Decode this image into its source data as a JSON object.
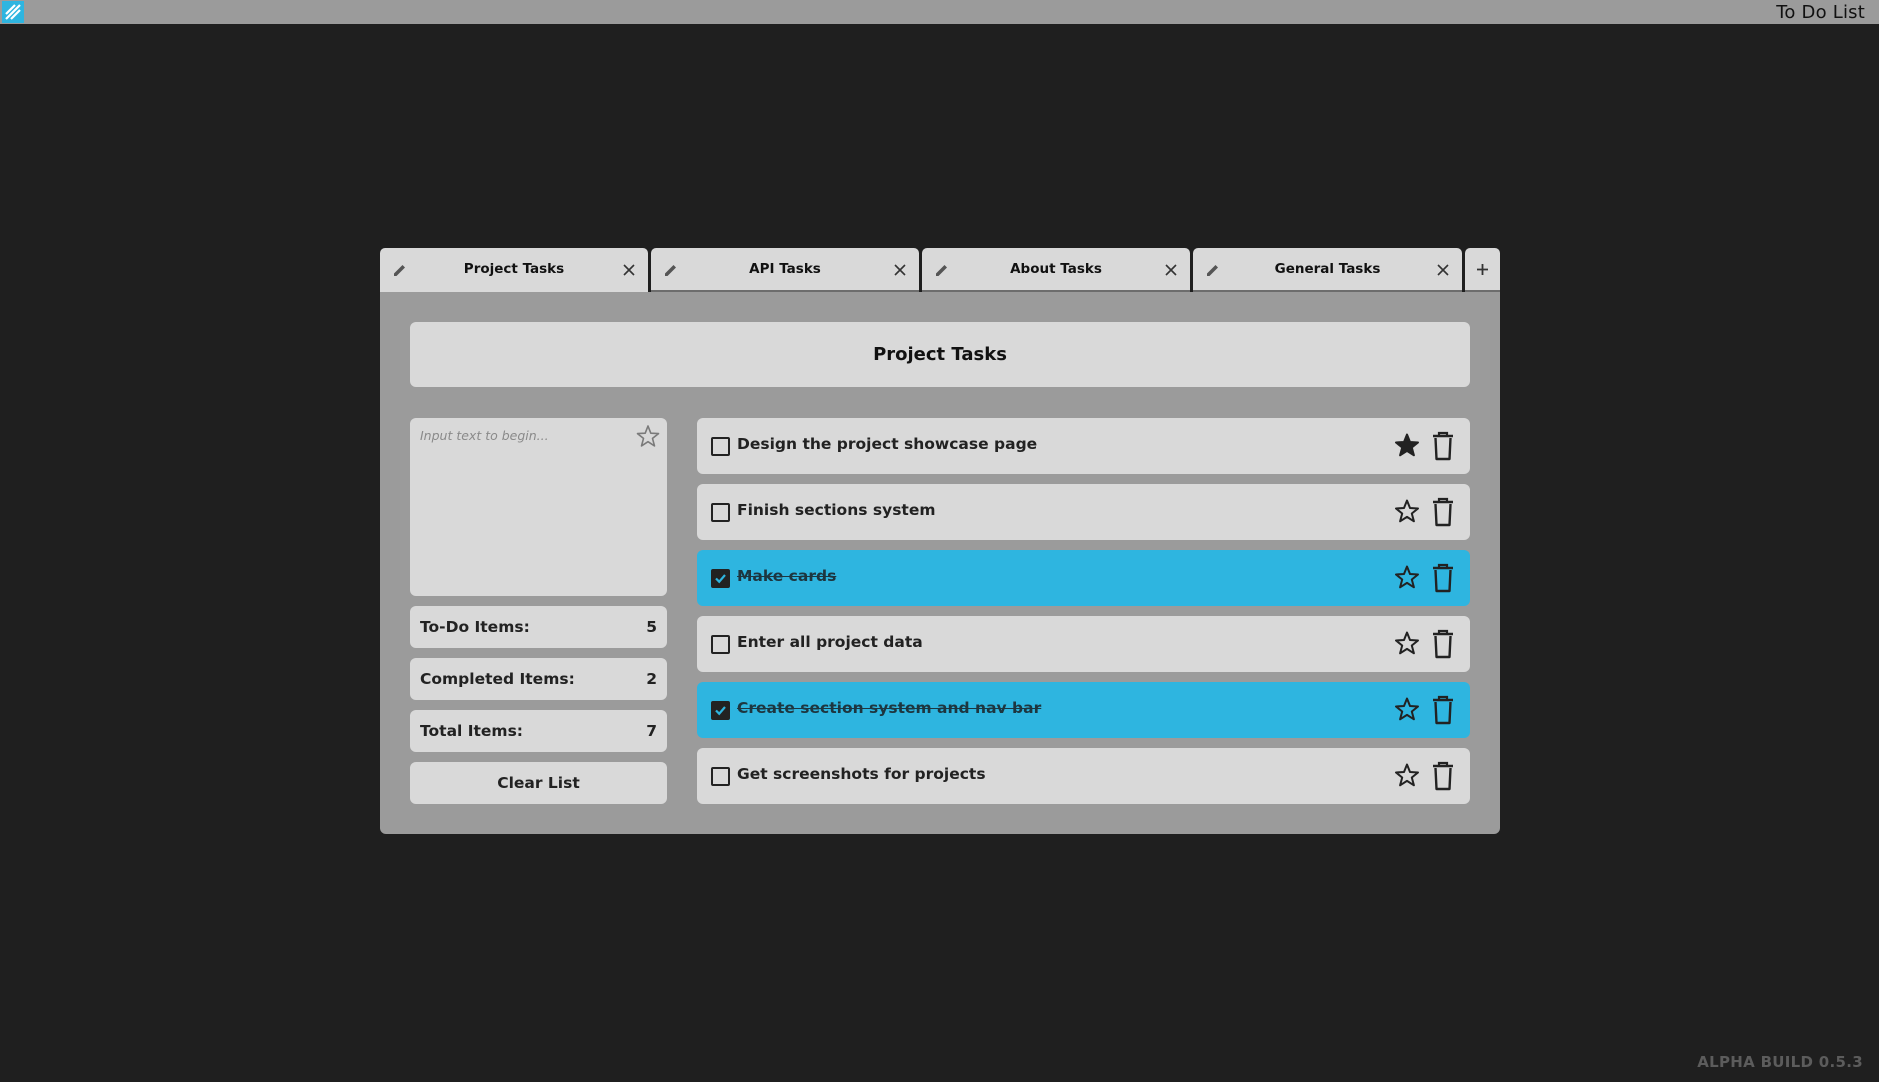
{
  "app": {
    "title": "To Do List",
    "build": "ALPHA BUILD 0.5.3"
  },
  "tabs": [
    {
      "label": "Project Tasks",
      "active": true
    },
    {
      "label": "API Tasks",
      "active": false
    },
    {
      "label": "About Tasks",
      "active": false
    },
    {
      "label": "General Tasks",
      "active": false
    }
  ],
  "list": {
    "title": "Project Tasks",
    "input_placeholder": "Input text to begin...",
    "stats": {
      "todo_label": "To-Do Items:",
      "todo_value": "5",
      "completed_label": "Completed Items:",
      "completed_value": "2",
      "total_label": "Total Items:",
      "total_value": "7"
    },
    "clear_label": "Clear List",
    "tasks": [
      {
        "text": "Design the project showcase page",
        "done": false,
        "starred": true
      },
      {
        "text": "Finish sections system",
        "done": false,
        "starred": false
      },
      {
        "text": "Make cards",
        "done": true,
        "starred": false
      },
      {
        "text": "Enter all project data",
        "done": false,
        "starred": false
      },
      {
        "text": "Create section system and nav bar",
        "done": true,
        "starred": false
      },
      {
        "text": "Get screenshots for projects",
        "done": false,
        "starred": false
      }
    ]
  },
  "colors": {
    "background": "#1f1f1f",
    "panel": "#9b9b9b",
    "card": "#d9d9d9",
    "done_accent": "#2eb5e0"
  },
  "icons": [
    "app-logo-icon",
    "pencil-icon",
    "close-icon",
    "plus-icon",
    "star-icon",
    "star-filled-icon",
    "trash-icon",
    "checkbox-icon"
  ]
}
